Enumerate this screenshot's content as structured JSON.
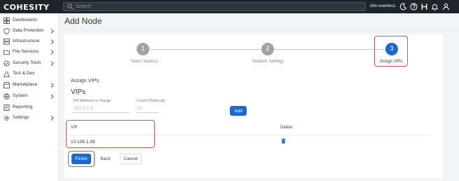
{
  "app": {
    "logo": "COHESITY",
    "cluster_name": "chx-xseries1"
  },
  "search": {
    "placeholder": "Search"
  },
  "sidebar": {
    "items": [
      {
        "label": "Dashboards",
        "icon": "dashboard-icon",
        "has_submenu": false
      },
      {
        "label": "Data Protection",
        "icon": "shield-icon",
        "has_submenu": true
      },
      {
        "label": "Infrastructure",
        "icon": "infrastructure-icon",
        "has_submenu": true
      },
      {
        "label": "File Services",
        "icon": "folder-icon",
        "has_submenu": true
      },
      {
        "label": "Security Tools",
        "icon": "security-icon",
        "has_submenu": true
      },
      {
        "label": "Test & Dev",
        "icon": "testdev-icon",
        "has_submenu": false
      },
      {
        "label": "Marketplace",
        "icon": "marketplace-icon",
        "has_submenu": true
      },
      {
        "label": "System",
        "icon": "system-icon",
        "has_submenu": true
      },
      {
        "label": "Reporting",
        "icon": "reporting-icon",
        "has_submenu": false
      },
      {
        "label": "Settings",
        "icon": "gear-icon",
        "has_submenu": true
      }
    ]
  },
  "page": {
    "title": "Add Node"
  },
  "stepper": {
    "steps": [
      {
        "number": "1",
        "label": "Select Node(s)",
        "state": "completed"
      },
      {
        "number": "2",
        "label": "Network Settings",
        "state": "completed"
      },
      {
        "number": "3",
        "label": "Assign VIPs",
        "state": "active"
      }
    ]
  },
  "assign": {
    "subtitle": "Assign VIPs",
    "section_title": "VIPs",
    "vip_field_label": "VIP Address or Range",
    "vip_field_placeholder": "192.0.2.1",
    "count_field_label": "Count (Optional)",
    "count_field_placeholder": "24",
    "add_button": "Add"
  },
  "table": {
    "columns": [
      "VIP",
      "Delete"
    ],
    "rows": [
      {
        "vip": "10.108.1.39"
      }
    ]
  },
  "actions": {
    "finish": "Finish",
    "back": "Back",
    "cancel": "Cancel"
  },
  "colors": {
    "topbar": "#1e2429",
    "primary": "#1a6ad0",
    "highlight": "#d9534f",
    "step_inactive": "#9ea3a8"
  }
}
